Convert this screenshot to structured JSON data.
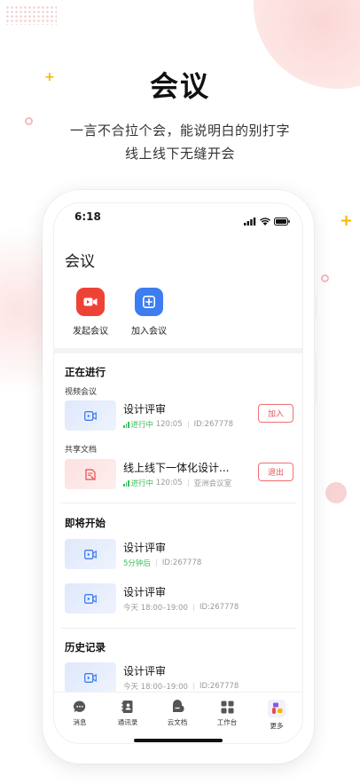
{
  "hero": {
    "title": "会议",
    "subtitle_line1": "一言不合拉个会，能说明白的别打字",
    "subtitle_line2": "线上线下无缝开会"
  },
  "colors": {
    "accent_red": "#ee4237",
    "accent_blue": "#3e7df0",
    "decor_yellow": "#f5b700",
    "status_green": "#3ebd5f"
  },
  "status_bar": {
    "time": "6:18",
    "icons": [
      "signal-icon",
      "wifi-icon",
      "battery-icon"
    ]
  },
  "app": {
    "title": "会议",
    "quick_actions": [
      {
        "label": "发起会议",
        "icon": "video-camera-icon"
      },
      {
        "label": "加入会议",
        "icon": "plus-square-icon"
      }
    ]
  },
  "ongoing": {
    "title": "正在进行",
    "video_label": "视频会议",
    "doc_label": "共享文档",
    "items": [
      {
        "title": "设计评审",
        "status": "进行中",
        "duration": "120:05",
        "extra": "ID:267778",
        "action": "加入",
        "icon": "video-icon"
      },
      {
        "title": "线上线下一体化设计...",
        "status": "进行中",
        "duration": "120:05",
        "extra": "亚洲会议室",
        "action": "退出",
        "icon": "document-icon"
      }
    ]
  },
  "upcoming": {
    "title": "即将开始",
    "items": [
      {
        "title": "设计评审",
        "time": "5分钟后",
        "id": "ID:267778"
      },
      {
        "title": "设计评审",
        "time": "今天 18:00–19:00",
        "id": "ID:267778"
      }
    ]
  },
  "history": {
    "title": "历史记录",
    "items": [
      {
        "title": "设计评审",
        "time": "今天 18:00–19:00",
        "id": "ID:267778"
      }
    ]
  },
  "tabbar": [
    {
      "label": "消息",
      "icon": "chat-bubble-icon"
    },
    {
      "label": "通讯录",
      "icon": "contacts-book-icon"
    },
    {
      "label": "云文档",
      "icon": "cloud-doc-icon"
    },
    {
      "label": "工作台",
      "icon": "grid-icon"
    },
    {
      "label": "更多",
      "icon": "more-apps-icon"
    }
  ]
}
